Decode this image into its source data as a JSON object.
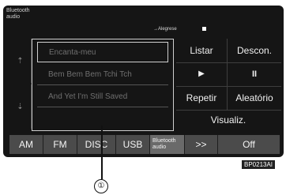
{
  "header": {
    "source_label_line1": "Bluetooth",
    "source_label_line2": "audio",
    "now_playing": "→Alegrese"
  },
  "tracks": [
    "Encanta-meu",
    "Bem Bem Bem Tchi Tch",
    "And Yet I'm Still Saved",
    ""
  ],
  "controls": {
    "listar": "Listar",
    "descon": "Descon.",
    "play": "▶",
    "pause": "⏸",
    "repetir": "Repetir",
    "aleatorio": "Aleatório",
    "visualiz": "Visualiz."
  },
  "scroll": {
    "up": "⇡",
    "down": "⇣"
  },
  "tabs": {
    "am": "AM",
    "fm": "FM",
    "disc": "DISC",
    "usb": "USB",
    "bt_line1": "Bluetooth",
    "bt_line2": "audio",
    "more": ">>",
    "off": "Off"
  },
  "figure_tag": "BP0213AI",
  "callout": "①"
}
